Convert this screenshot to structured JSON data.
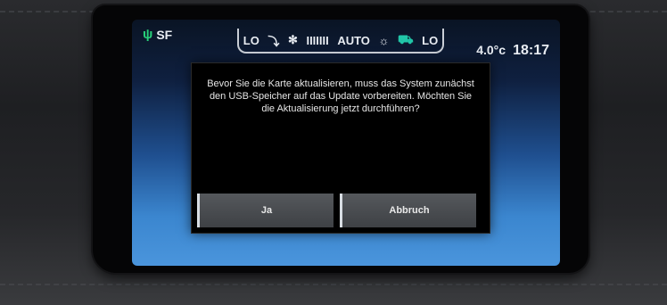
{
  "status": {
    "usb_icon": "usb-icon",
    "source": "SF",
    "climate": {
      "left_temp": "LO",
      "fan_bars": "IIIIIII",
      "mode": "AUTO",
      "right_temp": "LO"
    },
    "outside_temp": "4.0°c",
    "time": "18:17"
  },
  "dialog": {
    "message": "Bevor Sie die Karte aktualisieren, muss das System zunächst den USB-Speicher auf das Update vorbereiten. Möchten Sie die Aktualisierung jetzt durchführen?",
    "yes_label": "Ja",
    "cancel_label": "Abbruch"
  },
  "colors": {
    "accent": "#21c6a8",
    "usb": "#28d07a"
  }
}
